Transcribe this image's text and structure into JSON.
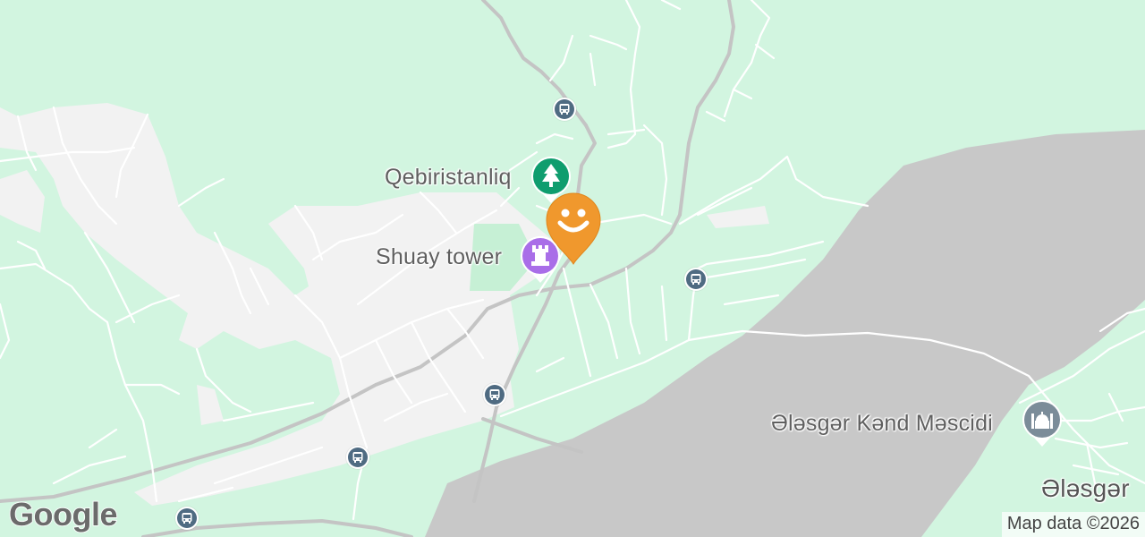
{
  "map": {
    "colors": {
      "land": "#d2f5e0",
      "urban": "#f2f2f2",
      "water": "#c8c8c8",
      "road_major": "#c4c4c4",
      "road_minor": "#ffffff",
      "park_pin": "#0f9d6e",
      "attraction_pin": "#a96ee8",
      "worship_pin": "#7b8c99",
      "custom_pin": "#f0982d",
      "transit": "#4f6b82"
    },
    "places": [
      {
        "name": "Qebiristanliq",
        "icon": "tree-icon"
      },
      {
        "name": "Shuay tower",
        "icon": "castle-tower-icon"
      },
      {
        "name": "Ələsgər Kənd Məscidi",
        "icon": "mosque-icon"
      }
    ],
    "town_label": "Ələsgər",
    "custom_marker_icon": "smiley-face-icon",
    "transit_icon": "bus-icon",
    "logo": "Google",
    "copyright": "Map data ©2026"
  }
}
